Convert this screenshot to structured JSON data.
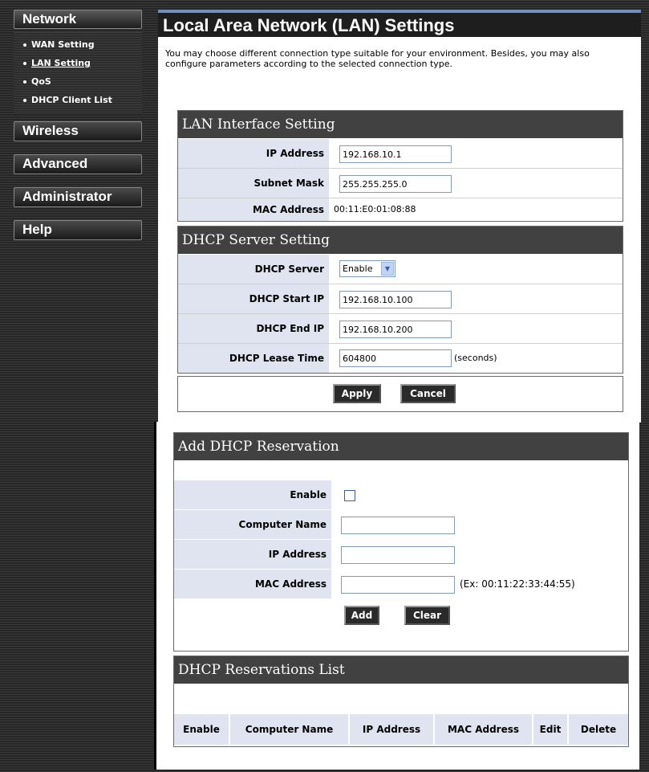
{
  "sidebar": {
    "network_label": "Network",
    "sub_items": [
      {
        "label": "WAN Setting"
      },
      {
        "label": "LAN Setting"
      },
      {
        "label": "QoS"
      },
      {
        "label": "DHCP Client List"
      }
    ],
    "wireless_label": "Wireless",
    "advanced_label": "Advanced",
    "administrator_label": "Administrator",
    "help_label": "Help"
  },
  "page": {
    "title": "Local Area Network (LAN) Settings",
    "intro": "You may choose different connection type suitable for your environment. Besides, you may also configure parameters according to the selected connection type."
  },
  "lan_interface": {
    "header": "LAN Interface Setting",
    "ip_label": "IP Address",
    "ip_value": "192.168.10.1",
    "mask_label": "Subnet Mask",
    "mask_value": "255.255.255.0",
    "mac_label": "MAC Address",
    "mac_value": "00:11:E0:01:08:88"
  },
  "dhcp_server": {
    "header": "DHCP Server Setting",
    "server_label": "DHCP Server",
    "server_value": "Enable",
    "start_label": "DHCP Start IP",
    "start_value": "192.168.10.100",
    "end_label": "DHCP End IP",
    "end_value": "192.168.10.200",
    "lease_label": "DHCP Lease Time",
    "lease_value": "604800",
    "lease_unit": "(seconds)"
  },
  "actions": {
    "apply_label": "Apply",
    "cancel_label": "Cancel"
  },
  "reservation": {
    "header": "Add DHCP Reservation",
    "enable_label": "Enable",
    "enable_checked": false,
    "computer_label": "Computer Name",
    "computer_value": "",
    "ip_label": "IP Address",
    "ip_value": "",
    "mac_label": "MAC Address",
    "mac_value": "",
    "mac_hint": "(Ex: 00:11:22:33:44:55)",
    "add_label": "Add",
    "clear_label": "Clear"
  },
  "reservations_list": {
    "header": "DHCP Reservations List",
    "columns": [
      "Enable",
      "Computer Name",
      "IP Address",
      "MAC Address",
      "Edit",
      "Delete"
    ]
  }
}
